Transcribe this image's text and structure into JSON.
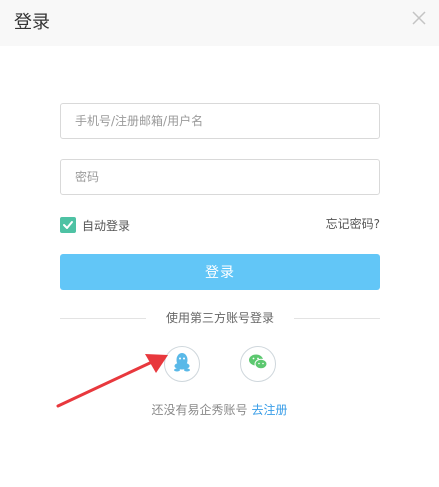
{
  "header": {
    "title": "登录",
    "close_icon": "close-icon"
  },
  "form": {
    "username_placeholder": "手机号/注册邮箱/用户名",
    "username_value": "",
    "password_placeholder": "密码",
    "password_value": "",
    "remember_label": "自动登录",
    "remember_checked": true,
    "forgot_label": "忘记密码?",
    "login_label": "登录"
  },
  "third_party": {
    "label": "使用第三方账号登录",
    "options": [
      {
        "icon": "qq-icon"
      },
      {
        "icon": "wechat-icon"
      }
    ]
  },
  "register": {
    "prompt": "还没有易企秀账号",
    "link": "去注册"
  },
  "annotation": {
    "icon": "red-arrow-icon"
  },
  "colors": {
    "accent": "#62c6f7",
    "checkbox": "#4ec2a4",
    "link": "#3a9ee8",
    "arrow": "#e8383d"
  }
}
